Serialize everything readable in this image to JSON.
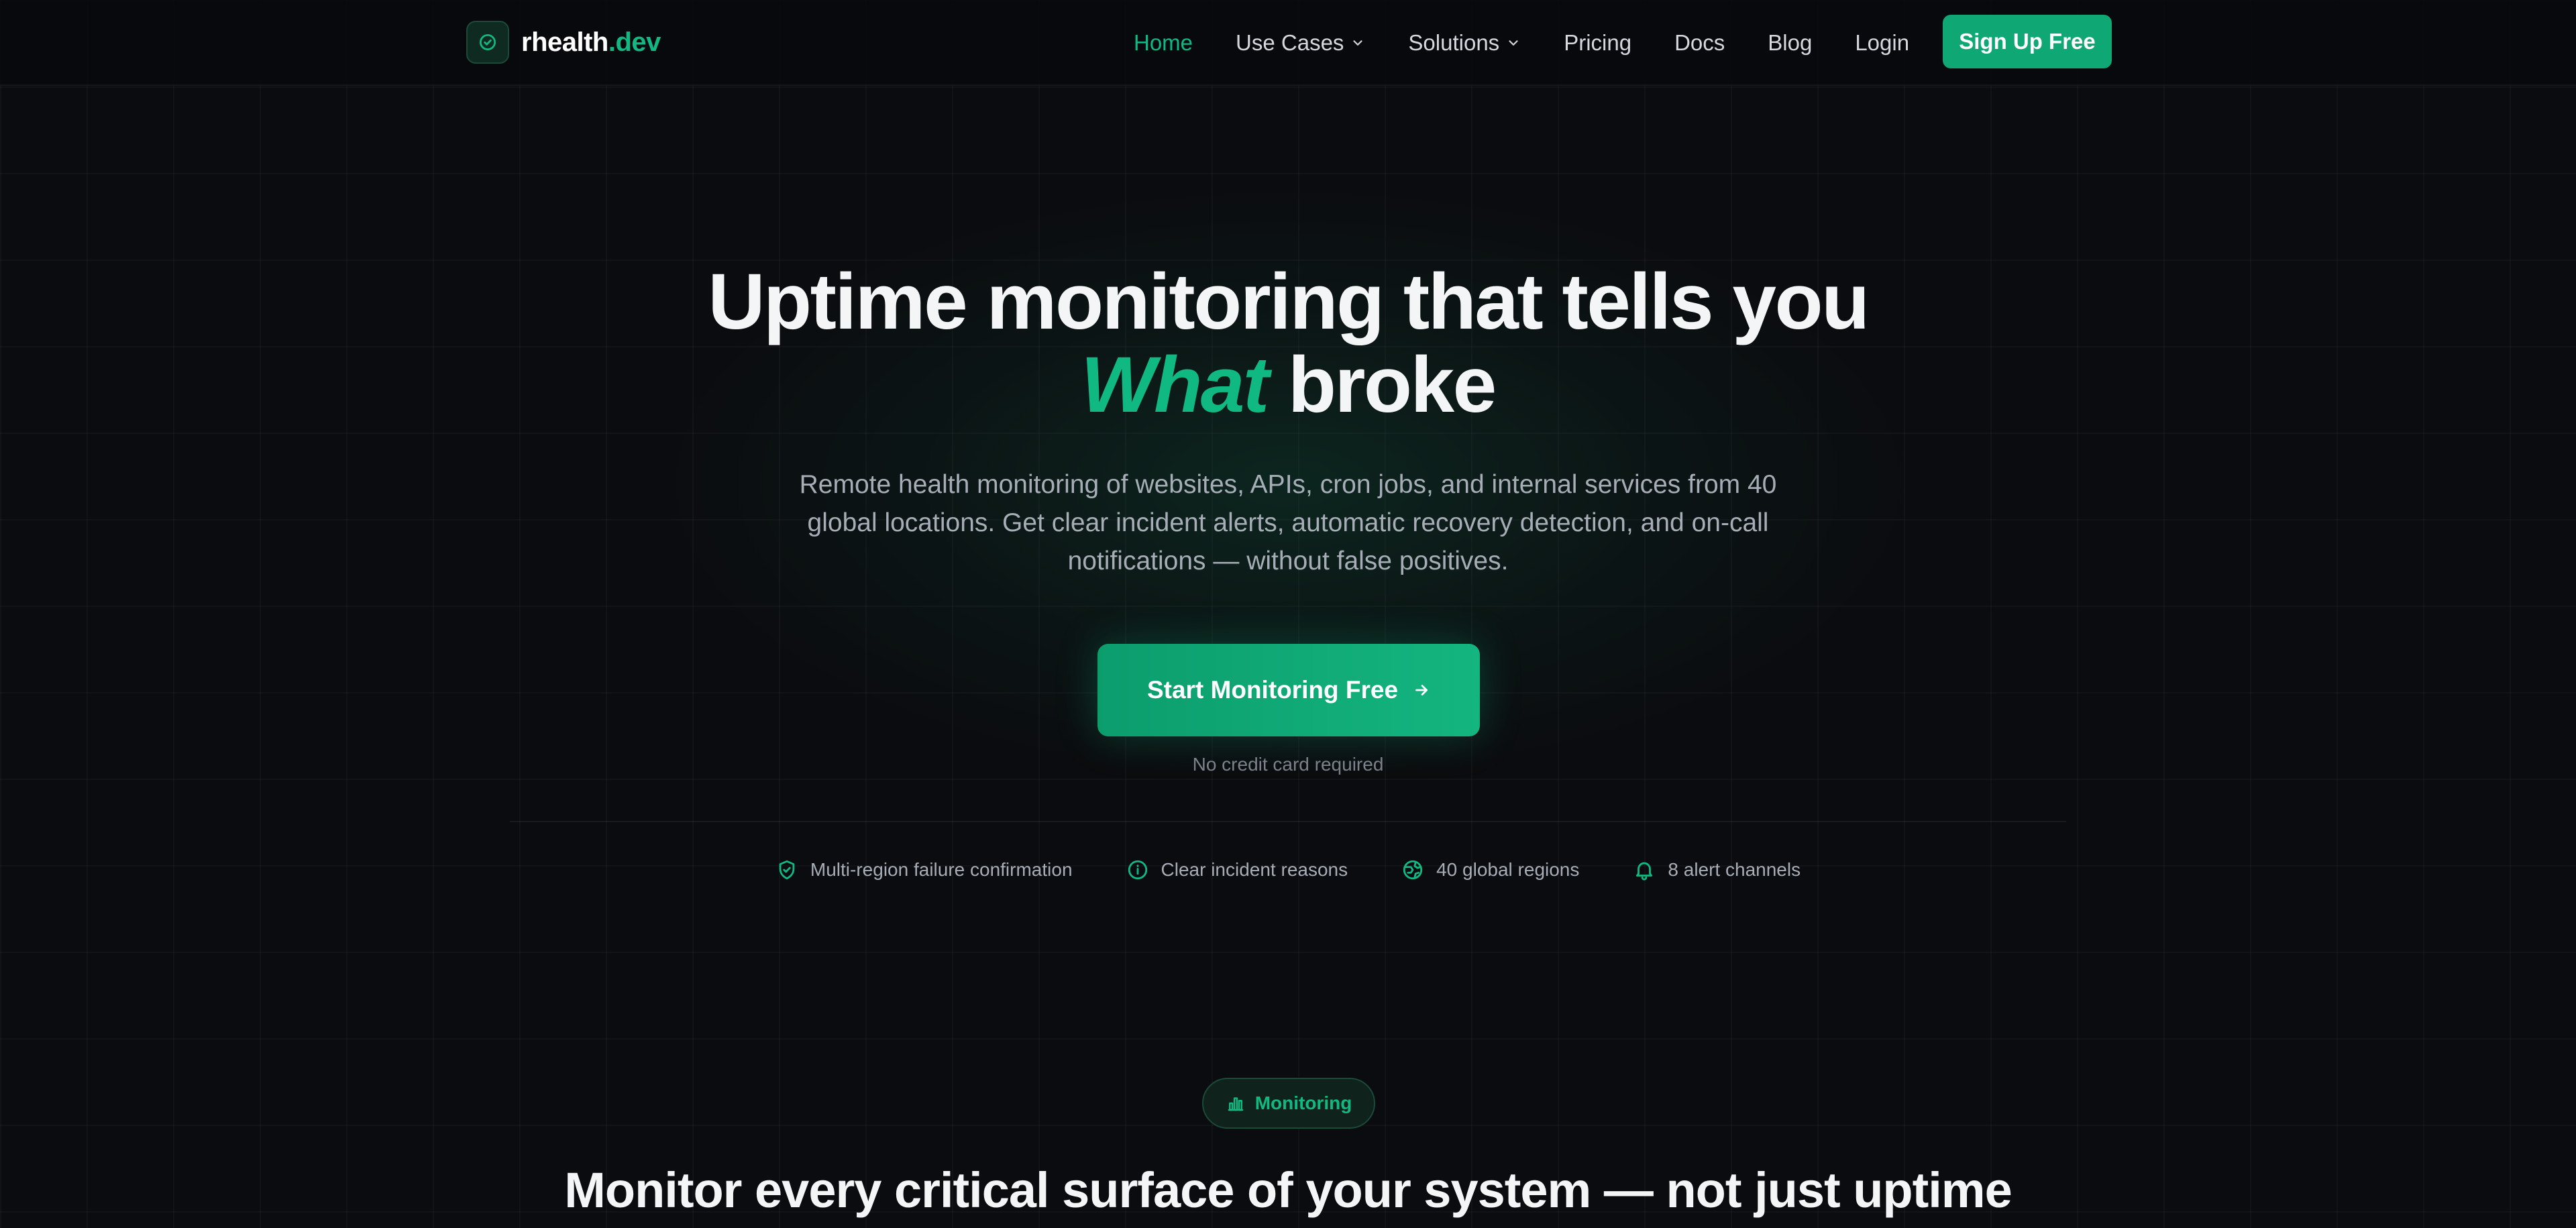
{
  "brand": {
    "part1": "rhealth",
    "part2": ".dev",
    "accent": "#10b981"
  },
  "nav": {
    "items": [
      {
        "label": "Home",
        "active": true
      },
      {
        "label": "Use Cases",
        "dropdown": true
      },
      {
        "label": "Solutions",
        "dropdown": true
      },
      {
        "label": "Pricing"
      },
      {
        "label": "Docs"
      },
      {
        "label": "Blog"
      },
      {
        "label": "Login"
      }
    ],
    "signup": "Sign Up Free"
  },
  "hero": {
    "title_line1": "Uptime monitoring that tells you",
    "title_highlight": "What",
    "title_rest": " broke",
    "subtitle": "Remote health monitoring of websites, APIs, cron jobs, and internal services from 40 global locations. Get clear incident alerts, automatic recovery detection, and on-call notifications — without false positives.",
    "cta": "Start Monitoring Free",
    "cta_note": "No credit card required"
  },
  "features": [
    {
      "icon": "shield-check-icon",
      "label": "Multi-region failure confirmation"
    },
    {
      "icon": "info-circle-icon",
      "label": "Clear incident reasons"
    },
    {
      "icon": "globe-icon",
      "label": "40 global regions"
    },
    {
      "icon": "bell-icon",
      "label": "8 alert channels"
    }
  ],
  "section": {
    "badge": "Monitoring",
    "badge_icon": "bar-chart-icon",
    "title": "Monitor every critical surface of your system — not just uptime"
  },
  "colors": {
    "background": "#0b0c0f",
    "accent": "#10b981",
    "button": "#0fa774"
  }
}
